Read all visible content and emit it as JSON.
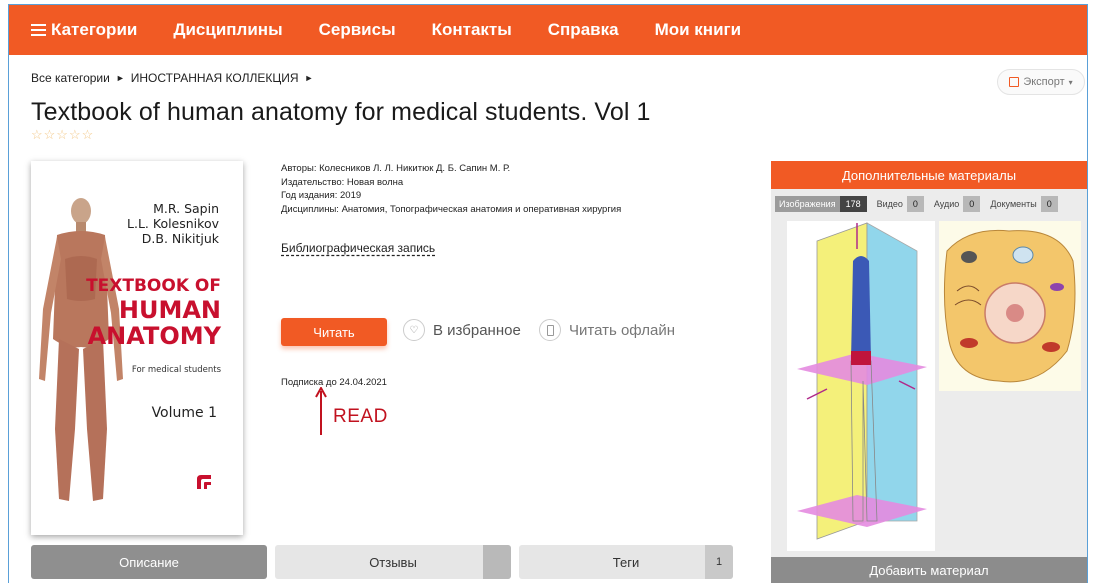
{
  "nav": {
    "items": [
      "Категории",
      "Дисциплины",
      "Сервисы",
      "Контакты",
      "Справка",
      "Мои книги"
    ]
  },
  "breadcrumb": {
    "items": [
      "Все категории",
      "ИНОСТРАННАЯ КОЛЛЕКЦИЯ"
    ],
    "separator": "►"
  },
  "export_label": "Экспорт",
  "book": {
    "title": "Textbook of human anatomy for medical students. Vol 1",
    "rating_stars": "☆☆☆☆☆",
    "authors": "Авторы: Колесников Л. Л. Никитюк Д. Б. Сапин М. Р.",
    "publisher": "Издательство: Новая волна",
    "year": "Год издания: 2019",
    "disciplines": "Дисциплины: Анатомия, Топографическая анатомия и оперативная хирургия",
    "biblio_link": "Библиографическая запись",
    "subscription": "Подписка до 24.04.2021"
  },
  "cover": {
    "authors": [
      "M.R. Sapin",
      "L.L. Kolesnikov",
      "D.B. Nikitjuk"
    ],
    "title_line1": "TEXTBOOK OF",
    "title_line2": "HUMAN",
    "title_line3": "ANATOMY",
    "subtitle": "For medical students",
    "volume": "Volume 1"
  },
  "actions": {
    "read": "Читать",
    "favorite": "В избранное",
    "offline": "Читать офлайн"
  },
  "annotation": {
    "label": "READ",
    "color": "#c1121f"
  },
  "tabs": [
    {
      "label": "Описание",
      "count": ""
    },
    {
      "label": "Отзывы",
      "count": ""
    },
    {
      "label": "Теги",
      "count": "1"
    }
  ],
  "side": {
    "header": "Дополнительные материалы",
    "tabs": [
      {
        "label": "Изображения",
        "count": "178"
      },
      {
        "label": "Видео",
        "count": "0"
      },
      {
        "label": "Аудио",
        "count": "0"
      },
      {
        "label": "Документы",
        "count": "0"
      }
    ],
    "add_button": "Добавить материал"
  },
  "colors": {
    "accent": "#f15a24",
    "cover_title": "#c8102e"
  }
}
